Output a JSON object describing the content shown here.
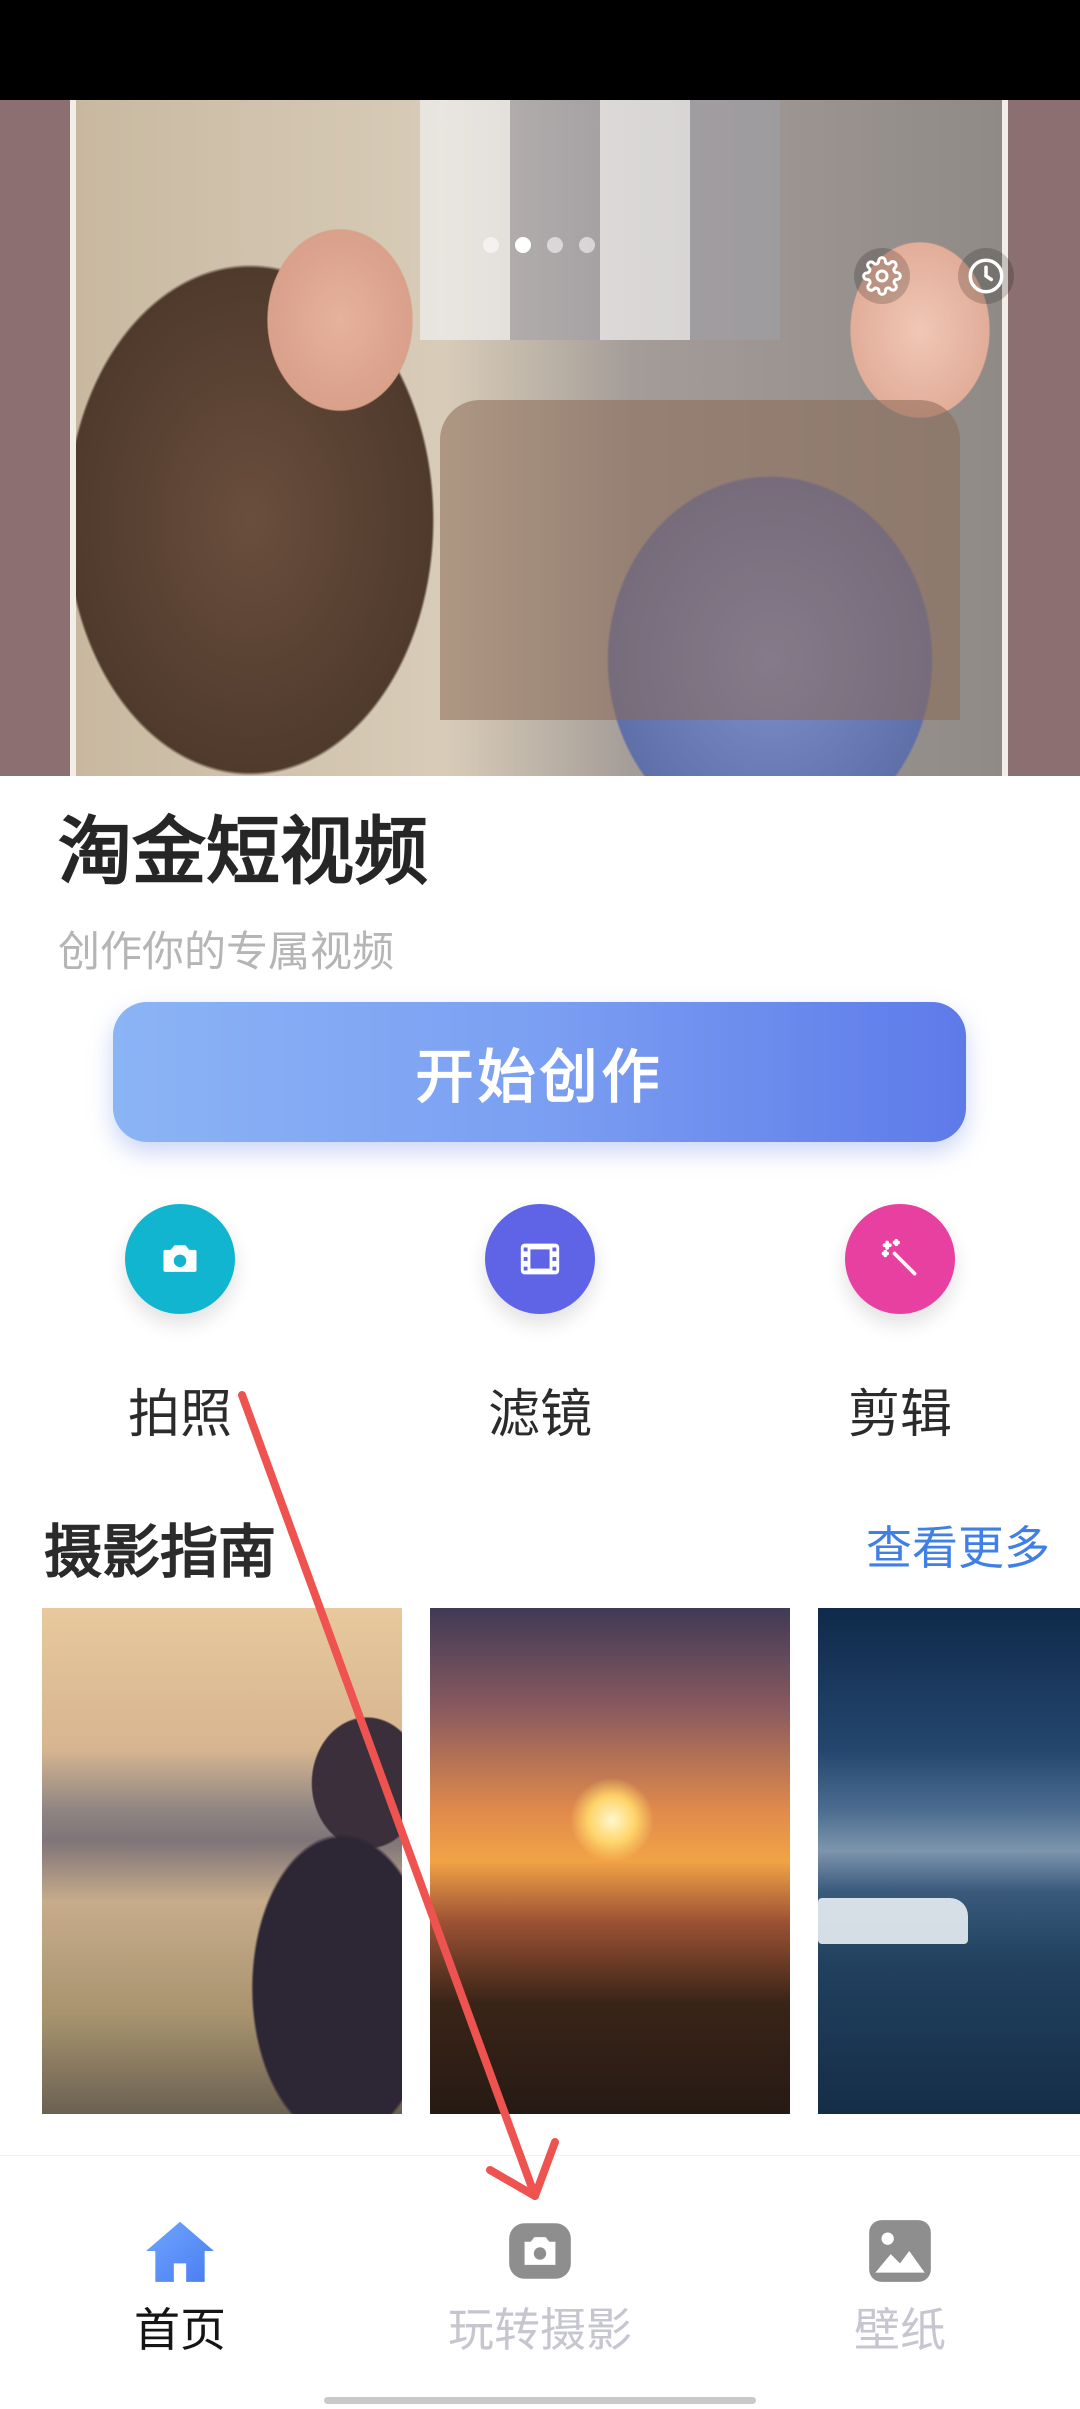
{
  "app": {
    "title": "淘金短视频",
    "subtitle": "创作你的专属视频"
  },
  "hero": {
    "carousel_pages": 4,
    "carousel_active_index": 1,
    "icons": [
      "gear-icon",
      "clock-icon"
    ]
  },
  "actions": {
    "start_label": "开始创作"
  },
  "tools": [
    {
      "label": "拍照",
      "icon": "camera-icon",
      "color": "#12b5d0"
    },
    {
      "label": "滤镜",
      "icon": "film-icon",
      "color": "#5f64e6"
    },
    {
      "label": "剪辑",
      "icon": "magic-wand-icon",
      "color": "#e840a0"
    }
  ],
  "guide": {
    "title": "摄影指南",
    "see_more": "查看更多"
  },
  "bottom_nav": [
    {
      "label": "首页",
      "icon": "home-icon",
      "active": true
    },
    {
      "label": "玩转摄影",
      "icon": "camera-icon",
      "active": false
    },
    {
      "label": "壁纸",
      "icon": "image-icon",
      "active": false
    }
  ],
  "colors": {
    "accent": "#5e7ae9",
    "link": "#3f7fe6",
    "annotation_arrow": "#ef5350"
  }
}
